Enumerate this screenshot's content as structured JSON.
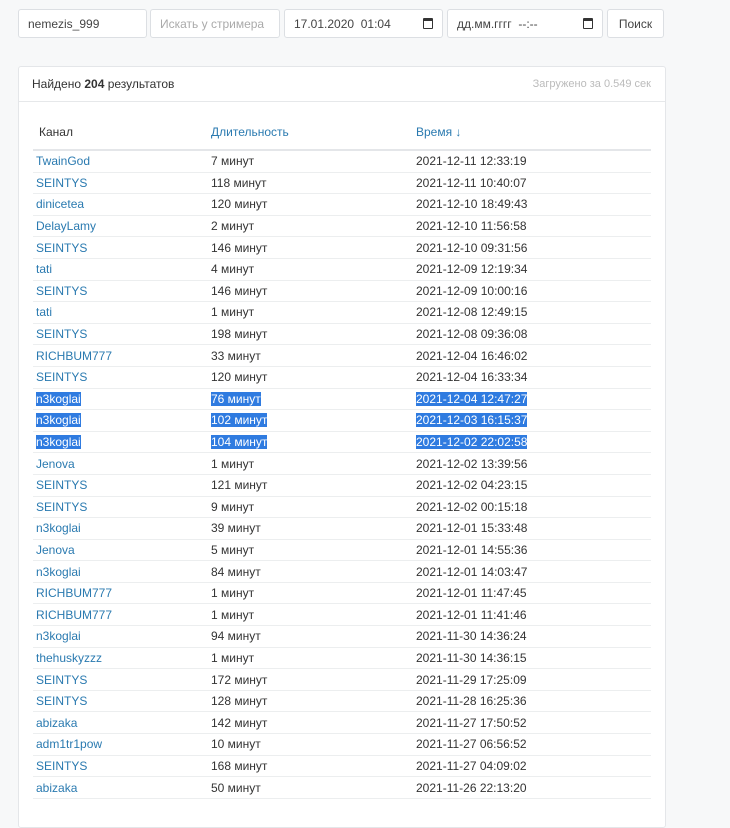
{
  "search": {
    "user_value": "nemezis_999",
    "streamer_placeholder": "Искать у стримера",
    "date_from": "17.01.2020  01:04",
    "date_to_placeholder": "дд.мм.гггг  --:--",
    "button": "Поиск"
  },
  "results": {
    "found_prefix": "Найдено ",
    "count": "204",
    "found_suffix": " результатов",
    "load_time": "Загружено за 0.549 сек"
  },
  "table": {
    "headers": [
      "Канал",
      "Длительность",
      "Время ↓"
    ],
    "rows": [
      [
        "TwainGod",
        "7 минут",
        "2021-12-11 12:33:19"
      ],
      [
        "SEINTYS",
        "118 минут",
        "2021-12-11 10:40:07"
      ],
      [
        "dinicetea",
        "120 минут",
        "2021-12-10 18:49:43"
      ],
      [
        "DelayLamy",
        "2 минут",
        "2021-12-10 11:56:58"
      ],
      [
        "SEINTYS",
        "146 минут",
        "2021-12-10 09:31:56"
      ],
      [
        "tati",
        "4 минут",
        "2021-12-09 12:19:34"
      ],
      [
        "SEINTYS",
        "146 минут",
        "2021-12-09 10:00:16"
      ],
      [
        "tati",
        "1 минут",
        "2021-12-08 12:49:15"
      ],
      [
        "SEINTYS",
        "198 минут",
        "2021-12-08 09:36:08"
      ],
      [
        "RICHBUM777",
        "33 минут",
        "2021-12-04 16:46:02"
      ],
      [
        "SEINTYS",
        "120 минут",
        "2021-12-04 16:33:34"
      ],
      [
        "n3koglai",
        "76 минут",
        "2021-12-04 12:47:27"
      ],
      [
        "n3koglai",
        "102 минут",
        "2021-12-03 16:15:37"
      ],
      [
        "n3koglai",
        "104 минут",
        "2021-12-02 22:02:58"
      ],
      [
        "Jenova",
        "1 минут",
        "2021-12-02 13:39:56"
      ],
      [
        "SEINTYS",
        "121 минут",
        "2021-12-02 04:23:15"
      ],
      [
        "SEINTYS",
        "9 минут",
        "2021-12-02 00:15:18"
      ],
      [
        "n3koglai",
        "39 минут",
        "2021-12-01 15:33:48"
      ],
      [
        "Jenova",
        "5 минут",
        "2021-12-01 14:55:36"
      ],
      [
        "n3koglai",
        "84 минут",
        "2021-12-01 14:03:47"
      ],
      [
        "RICHBUM777",
        "1 минут",
        "2021-12-01 11:47:45"
      ],
      [
        "RICHBUM777",
        "1 минут",
        "2021-12-01 11:41:46"
      ],
      [
        "n3koglai",
        "94 минут",
        "2021-11-30 14:36:24"
      ],
      [
        "thehuskyzzz",
        "1 минут",
        "2021-11-30 14:36:15"
      ],
      [
        "SEINTYS",
        "172 минут",
        "2021-11-29 17:25:09"
      ],
      [
        "SEINTYS",
        "128 минут",
        "2021-11-28 16:25:36"
      ],
      [
        "abizaka",
        "142 минут",
        "2021-11-27 17:50:52"
      ],
      [
        "adm1tr1pow",
        "10 минут",
        "2021-11-27 06:56:52"
      ],
      [
        "SEINTYS",
        "168 минут",
        "2021-11-27 04:09:02"
      ],
      [
        "abizaka",
        "50 минут",
        "2021-11-26 22:13:20"
      ]
    ],
    "selected_rows": [
      11,
      12,
      13
    ]
  }
}
